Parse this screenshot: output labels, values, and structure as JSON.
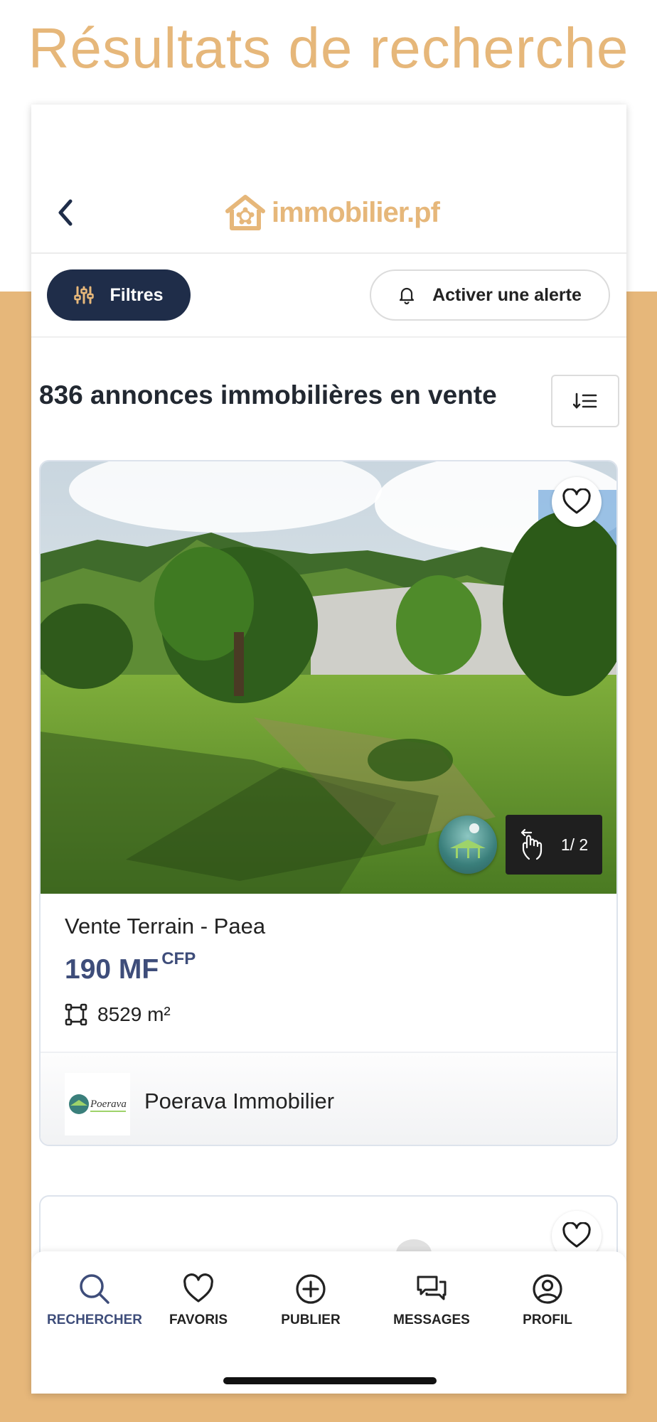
{
  "promo": {
    "title": "Résultats de recherche"
  },
  "header": {
    "logo_text": "immobilier.pf"
  },
  "filters": {
    "filters_label": "Filtres",
    "alert_label": "Activer une alerte"
  },
  "results": {
    "count_title": "836 annonces immobilières en vente"
  },
  "listing": {
    "title": "Vente Terrain - Paea",
    "price": "190 MF",
    "currency": "CFP",
    "area": "8529 m²",
    "photo_counter": "1/ 2",
    "agency_name": "Poerava Immobilier",
    "agency_logo_text": "Poerava"
  },
  "nav": {
    "items": [
      {
        "label": "RECHERCHER",
        "icon": "search-icon",
        "active": true
      },
      {
        "label": "FAVORIS",
        "icon": "heart-icon",
        "active": false
      },
      {
        "label": "PUBLIER",
        "icon": "plus-circle-icon",
        "active": false
      },
      {
        "label": "MESSAGES",
        "icon": "chat-icon",
        "active": false
      },
      {
        "label": "PROFIL",
        "icon": "user-circle-icon",
        "active": false
      }
    ]
  },
  "colors": {
    "brand": "#e6b77a",
    "navy": "#1f2d49",
    "price": "#3e4d7a"
  }
}
